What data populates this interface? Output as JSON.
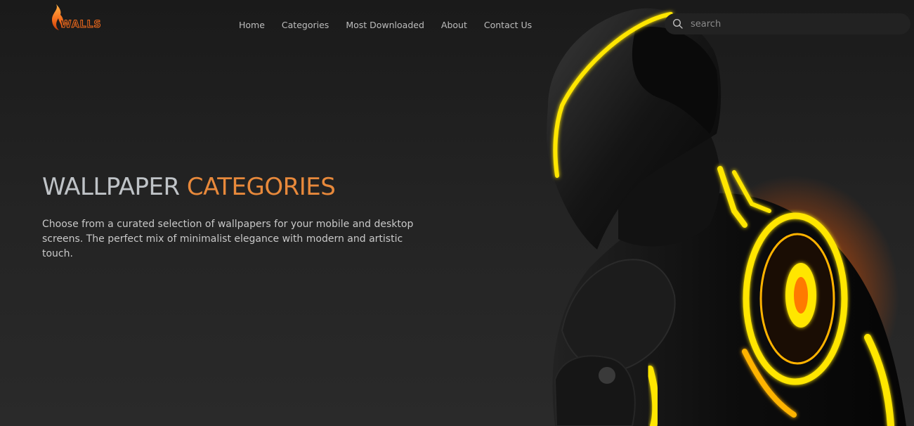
{
  "brand": {
    "logo_text": "WALLS",
    "accent_color": "#f36b1c"
  },
  "nav": {
    "items": [
      {
        "label": "Home"
      },
      {
        "label": "Categories"
      },
      {
        "label": "Most Downloaded"
      },
      {
        "label": "About"
      },
      {
        "label": "Contact Us"
      }
    ]
  },
  "search": {
    "placeholder": "search",
    "value": "",
    "icon": "search-icon"
  },
  "hero": {
    "title_part1": "WALLPAPER",
    "title_part2": "CATEGORIES",
    "title_color_part1": "#bfc3c7",
    "title_color_part2": "#e8893b",
    "description": "Choose from a curated selection of wallpapers for your mobile and desktop screens. The perfect mix of minimalist elegance with modern and artistic touch."
  },
  "artwork": {
    "glow_colors": [
      "#ffe600",
      "#ff6a00"
    ]
  }
}
